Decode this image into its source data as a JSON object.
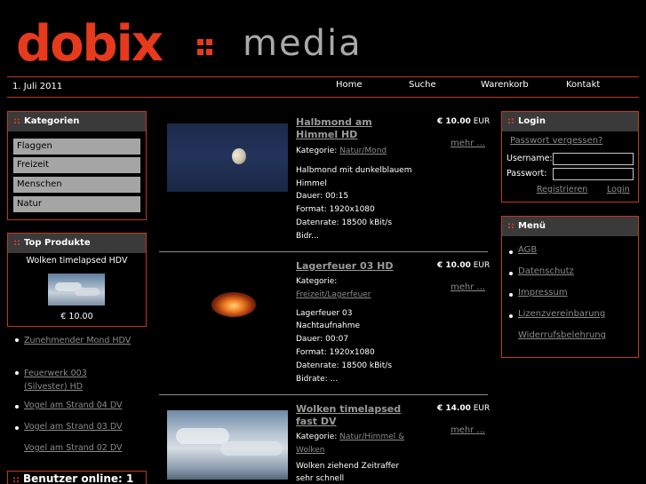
{
  "header": {
    "logo_left": "dobix",
    "logo_right": "media",
    "date": "1. Juli 2011",
    "nav": [
      "Home",
      "Suche",
      "Warenkorb",
      "Kontakt"
    ]
  },
  "colors": {
    "accent": "#e63a1c",
    "box_header": "#3a3a3a",
    "link": "#8a8a8a"
  },
  "categories": {
    "title": "Kategorien",
    "items": [
      "Flaggen",
      "Freizeit",
      "Menschen",
      "Natur"
    ]
  },
  "top_products": {
    "title": "Top Produkte",
    "name": "Wolken timelapsed HDV",
    "price": "€ 10.00"
  },
  "side_links": [
    "Zunehmender Mond HDV",
    "Feuerwerk 003 (Silvester) HD",
    "Vogel am Strand 04 DV",
    "Vogel am Strand 03 DV",
    "Vogel am Strand 02 DV"
  ],
  "users_online": "Benutzer online: 1",
  "products": [
    {
      "title": "Halbmond am Himmel HD",
      "category_label": "Kategorie:",
      "category": "Natur/Mond",
      "lines": [
        "Halbmond mit dunkelblauem",
        "Himmel",
        "Dauer: 00:15",
        "Format: 1920x1080",
        "Datenrate: 18500 kBit/s",
        "Bidr..."
      ],
      "price": "€ 10.00",
      "currency": "EUR",
      "more": "mehr ..."
    },
    {
      "title": "Lagerfeuer 03 HD",
      "category_label": "Kategorie:",
      "category": "Freizeit/Lagerfeuer",
      "lines": [
        "Lagerfeuer 03",
        "Nachtaufnahme",
        "Dauer: 00:07",
        "Format: 1920x1080",
        "Datenrate: 18500 kBit/s",
        "Bidrate: ..."
      ],
      "price": "€ 10.00",
      "currency": "EUR",
      "more": "mehr ..."
    },
    {
      "title": "Wolken timelapsed fast DV",
      "category_label": "Kategorie:",
      "category": "Natur/Himmel & Wolken",
      "lines": [
        "Wolken ziehend Zeitraffer",
        "sehr schnell"
      ],
      "price": "€ 14.00",
      "currency": "EUR",
      "more": "mehr ..."
    }
  ],
  "login": {
    "title": "Login",
    "forgot": "Passwort vergessen?",
    "username_label": "Username:",
    "password_label": "Passwort:",
    "register": "Registrieren",
    "login": "Login"
  },
  "menu": {
    "title": "Menü",
    "items": [
      "AGB",
      "Datenschutz",
      "Impressum",
      "Lizenzvereinbarung",
      "Widerrufsbelehrung"
    ]
  }
}
